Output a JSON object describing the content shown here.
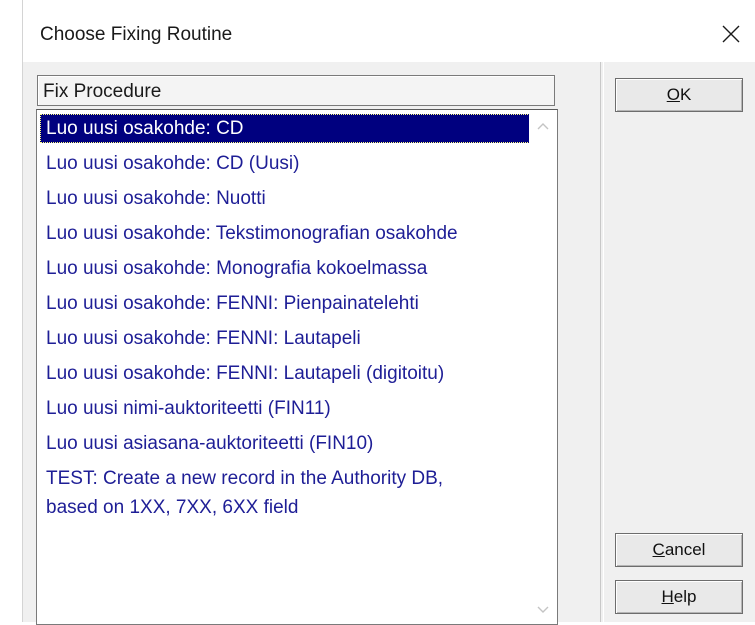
{
  "window": {
    "title": "Choose Fixing Routine",
    "close_icon": "close-icon"
  },
  "list": {
    "column_header": "Fix Procedure",
    "items": [
      {
        "label": "Luo uusi osakohde: CD",
        "selected": true
      },
      {
        "label": "Luo uusi osakohde: CD (Uusi)"
      },
      {
        "label": "Luo uusi osakohde: Nuotti"
      },
      {
        "label": "Luo uusi osakohde: Tekstimonografian osakohde"
      },
      {
        "label": "Luo uusi osakohde: Monografia kokoelmassa"
      },
      {
        "label": "Luo uusi osakohde: FENNI: Pienpainatelehti"
      },
      {
        "label": "Luo uusi osakohde: FENNI: Lautapeli"
      },
      {
        "label": "Luo uusi osakohde: FENNI: Lautapeli (digitoitu)"
      },
      {
        "label": "Luo uusi nimi-auktoriteetti (FIN11)"
      },
      {
        "label": "Luo uusi asiasana-auktoriteetti (FIN10)"
      },
      {
        "label": "TEST: Create a new record in the Authority DB,"
      },
      {
        "label": "based on 1XX, 7XX, 6XX field"
      }
    ]
  },
  "buttons": {
    "ok": {
      "mnemonic": "O",
      "rest": "K"
    },
    "cancel": {
      "mnemonic": "C",
      "rest": "ancel"
    },
    "help": {
      "mnemonic": "H",
      "rest": "elp"
    }
  },
  "colors": {
    "selection": "#00007f",
    "item_text": "#1e1e96"
  }
}
